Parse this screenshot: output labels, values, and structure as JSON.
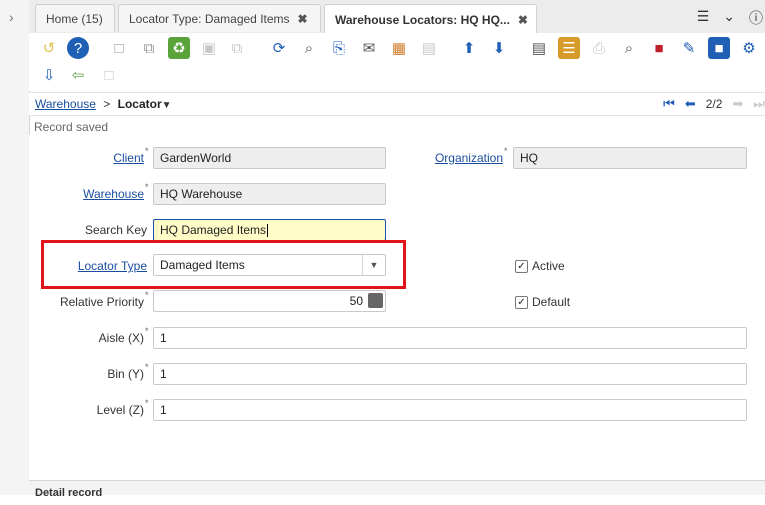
{
  "tabs": [
    {
      "label": "Home (15)",
      "closable": false,
      "active": false
    },
    {
      "label": "Locator Type: Damaged Items",
      "closable": true,
      "active": false
    },
    {
      "label": "Warehouse Locators: HQ HQ...",
      "closable": true,
      "active": true
    }
  ],
  "tabbar_tools": [
    "menu-icon",
    "chevron-down-icon",
    "help-icon"
  ],
  "breadcrumb": {
    "parent": "Warehouse",
    "separator": ">",
    "current": "Locator"
  },
  "navigation": {
    "record_position": "2/2"
  },
  "status": "Record saved",
  "form": {
    "client": {
      "label": "Client",
      "value": "GardenWorld"
    },
    "organization": {
      "label": "Organization",
      "value": "HQ"
    },
    "warehouse": {
      "label": "Warehouse",
      "value": "HQ Warehouse"
    },
    "search_key": {
      "label": "Search Key",
      "value": "HQ Damaged Items"
    },
    "locator_type": {
      "label": "Locator Type",
      "value": "Damaged Items"
    },
    "active": {
      "label": "Active",
      "checked": true
    },
    "relative_priority": {
      "label": "Relative Priority",
      "value": "50"
    },
    "default": {
      "label": "Default",
      "checked": true
    },
    "aisle": {
      "label": "Aisle (X)",
      "value": "1"
    },
    "bin": {
      "label": "Bin (Y)",
      "value": "1"
    },
    "level": {
      "label": "Level (Z)",
      "value": "1"
    }
  },
  "detail_label": "Detail record",
  "colors": {
    "link": "#1a4fa0",
    "highlight": "#e0141a",
    "focus_bg": "#fffcc8",
    "nav_blue": "#1e5bb8"
  }
}
